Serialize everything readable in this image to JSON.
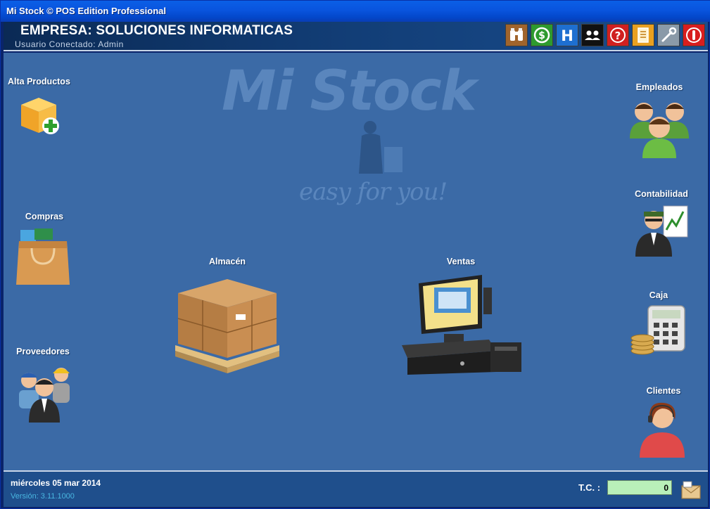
{
  "window": {
    "title": "Mi Stock © POS Edition Professional"
  },
  "header": {
    "company": "EMPRESA: SOLUCIONES INFORMATICAS",
    "user": "Usuario Conectado: Admin"
  },
  "toolbar": {
    "buttons": [
      {
        "name": "binoculars-icon",
        "color": "#a0642c"
      },
      {
        "name": "dollar-icon",
        "color": "#2e9a2e"
      },
      {
        "name": "hotel-icon",
        "color": "#1e6fd0"
      },
      {
        "name": "people-icon",
        "color": "#111111"
      },
      {
        "name": "help-icon",
        "color": "#d02020"
      },
      {
        "name": "document-icon",
        "color": "#e8a020"
      },
      {
        "name": "wrench-icon",
        "color": "#8a9aa8"
      },
      {
        "name": "power-icon",
        "color": "#d81e1e"
      }
    ]
  },
  "watermark": {
    "title": "Mi Stock",
    "subtitle": "easy for you!"
  },
  "tiles": {
    "alta_productos": "Alta Productos",
    "compras": "Compras",
    "proveedores": "Proveedores",
    "almacen": "Almacén",
    "ventas": "Ventas",
    "empleados": "Empleados",
    "contabilidad": "Contabilidad",
    "caja": "Caja",
    "clientes": "Clientes"
  },
  "footer": {
    "date": "miércoles 05 mar 2014",
    "version": "Versión: 3.11.1000",
    "tc_label": "T.C. :",
    "tc_value": "0"
  }
}
